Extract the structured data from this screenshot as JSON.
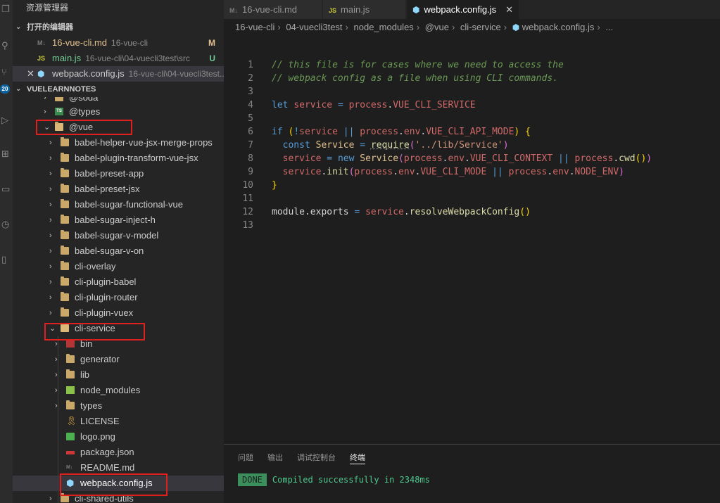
{
  "explorer": {
    "title": "资源管理器",
    "open_editors_header": "打开的编辑器",
    "project_header": "VUELEARNNOTES",
    "badge": "20",
    "open_editors": [
      {
        "name": "16-vue-cli.md",
        "path": "16-vue-cli",
        "status": "M",
        "icon": "markdown-icon",
        "icon_text": "M↓"
      },
      {
        "name": "main.js",
        "path": "16-vue-cli\\04-vuecli3test\\src",
        "status": "U",
        "icon": "javascript-icon",
        "icon_text": "JS"
      },
      {
        "name": "webpack.config.js",
        "path": "16-vue-cli\\04-vuecli3test...",
        "status": "",
        "icon": "webpack-icon",
        "icon_text": "⬢"
      }
    ],
    "tree": [
      {
        "label": "@soda",
        "expanded": false
      },
      {
        "label": "@types",
        "expanded": false
      },
      {
        "label": "@vue",
        "expanded": true
      },
      {
        "label": "babel-helper-vue-jsx-merge-props",
        "expanded": false
      },
      {
        "label": "babel-plugin-transform-vue-jsx",
        "expanded": false
      },
      {
        "label": "babel-preset-app",
        "expanded": false
      },
      {
        "label": "babel-preset-jsx",
        "expanded": false
      },
      {
        "label": "babel-sugar-functional-vue",
        "expanded": false
      },
      {
        "label": "babel-sugar-inject-h",
        "expanded": false
      },
      {
        "label": "babel-sugar-v-model",
        "expanded": false
      },
      {
        "label": "babel-sugar-v-on",
        "expanded": false
      },
      {
        "label": "cli-overlay",
        "expanded": false
      },
      {
        "label": "cli-plugin-babel",
        "expanded": false
      },
      {
        "label": "cli-plugin-router",
        "expanded": false
      },
      {
        "label": "cli-plugin-vuex",
        "expanded": false
      },
      {
        "label": "cli-service",
        "expanded": true
      },
      {
        "label": "bin",
        "expanded": false
      },
      {
        "label": "generator",
        "expanded": false
      },
      {
        "label": "lib",
        "expanded": false
      },
      {
        "label": "node_modules",
        "expanded": false
      },
      {
        "label": "types",
        "expanded": false
      },
      {
        "label": "LICENSE"
      },
      {
        "label": "logo.png"
      },
      {
        "label": "package.json"
      },
      {
        "label": "README.md"
      },
      {
        "label": "webpack.config.js"
      },
      {
        "label": "cli-shared-utils",
        "expanded": false
      }
    ]
  },
  "tabs": [
    {
      "label": "16-vue-cli.md",
      "icon_text": "M↓"
    },
    {
      "label": "main.js",
      "icon_text": "JS"
    },
    {
      "label": "webpack.config.js",
      "icon_text": "⬢"
    }
  ],
  "breadcrumbs": [
    "16-vue-cli",
    "04-vuecli3test",
    "node_modules",
    "@vue",
    "cli-service",
    "webpack.config.js",
    "..."
  ],
  "editor": {
    "line_numbers": [
      "1",
      "2",
      "3",
      "4",
      "5",
      "6",
      "7",
      "8",
      "9",
      "10",
      "11",
      "12",
      "13"
    ]
  },
  "panel": {
    "tabs": [
      "问题",
      "输出",
      "调试控制台",
      "终端"
    ],
    "active_tab": "终端",
    "terminal": {
      "badge": "DONE",
      "message": "Compiled successfully in 2348ms"
    }
  },
  "colors": {
    "highlight_box": "#e01f1f",
    "folder": "#c9a86a",
    "done_badge": "#3a8f5c"
  }
}
